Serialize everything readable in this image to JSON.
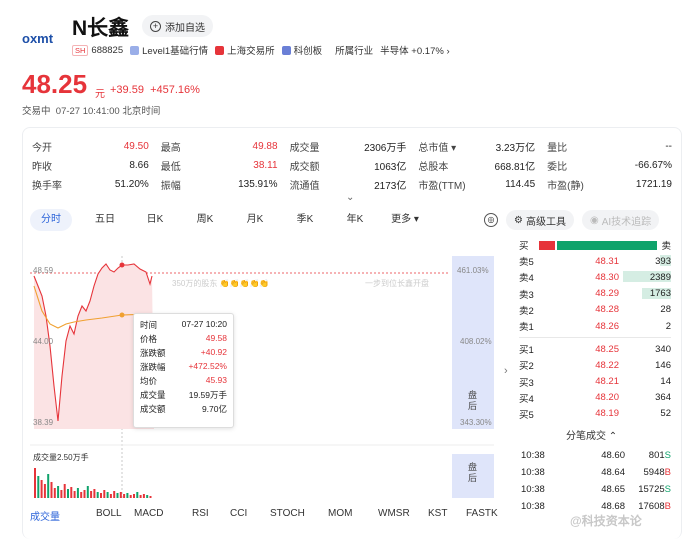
{
  "stock": {
    "name": "N长鑫",
    "add_label": "添加自选",
    "code_tag": "SH",
    "code": "688825",
    "level1": "Level1基础行情",
    "exchange": "上海交易所",
    "board": "科创板",
    "industry_label": "所属行业",
    "industry": "半导体 +0.17%",
    "industry_chevron": "›",
    "price": "48.25",
    "price_unit": "元",
    "change": "+39.59",
    "change_pct": "+457.16%",
    "status": "交易中",
    "time": "07-27 10:41:00 北京时间"
  },
  "stats": [
    [
      [
        "今开",
        "49.50",
        "red"
      ],
      [
        "最高",
        "49.88",
        "red"
      ],
      [
        "成交量",
        "2306万手",
        ""
      ],
      [
        "总市值 ▾",
        "3.23万亿",
        ""
      ],
      [
        "量比",
        "--",
        ""
      ]
    ],
    [
      [
        "昨收",
        "8.66",
        ""
      ],
      [
        "最低",
        "38.11",
        "red"
      ],
      [
        "成交额",
        "1063亿",
        ""
      ],
      [
        "总股本",
        "668.81亿",
        ""
      ],
      [
        "委比",
        "-66.67%",
        ""
      ]
    ],
    [
      [
        "换手率",
        "51.20%",
        ""
      ],
      [
        "振幅",
        "135.91%",
        ""
      ],
      [
        "流通值",
        "2173亿",
        ""
      ],
      [
        "市盈(TTM)",
        "114.45",
        ""
      ],
      [
        "市盈(静)",
        "1721.19",
        ""
      ]
    ]
  ],
  "expand_icon": "⌄",
  "tabs": [
    "分时",
    "五日",
    "日K",
    "周K",
    "月K",
    "季K",
    "年K",
    "更多 ▾"
  ],
  "tools": {
    "target_icon": "◎",
    "draw_label": "高级工具",
    "ai_label": "AI技术追踪"
  },
  "chart": {
    "y_high": "48.59",
    "y_mid": "44.00",
    "y_low": "38.39",
    "pct_high": "461.03%",
    "pct_mid": "408.02%",
    "pct_low": "343.30%",
    "side_label_1": "盘后",
    "side_label_2": "盘后",
    "ghost_text_1": "350万的股东 👏👏👏👏👏",
    "ghost_text_2": "一步到位长鑫开盘",
    "volume_label": "成交量2.50万手",
    "colors": {
      "up": "#e6343a",
      "avg": "#f0a030",
      "fill": "#fbe3e4"
    }
  },
  "tooltip": {
    "rows": [
      [
        "时间",
        "07-27 10:20",
        ""
      ],
      [
        "价格",
        "49.58",
        "red"
      ],
      [
        "涨跌额",
        "+40.92",
        "red"
      ],
      [
        "涨跌幅",
        "+472.52%",
        "red"
      ],
      [
        "均价",
        "45.93",
        "red"
      ],
      [
        "成交量",
        "19.59万手",
        ""
      ],
      [
        "成交额",
        "9.70亿",
        ""
      ]
    ]
  },
  "indicators": [
    "成交量",
    "BOLL",
    "MACD",
    "RSI",
    "CCI",
    "STOCH",
    "MOM",
    "WMSR",
    "KST",
    "FASTK"
  ],
  "orderbook": {
    "buy_label": "买",
    "sell_label": "卖",
    "asks": [
      [
        "卖5",
        "48.31",
        "393",
        0.22
      ],
      [
        "卖4",
        "48.30",
        "2389",
        1.0
      ],
      [
        "卖3",
        "48.29",
        "1763",
        0.6
      ],
      [
        "卖2",
        "48.28",
        "28",
        0
      ],
      [
        "卖1",
        "48.26",
        "2",
        0
      ]
    ],
    "bids": [
      [
        "买1",
        "48.25",
        "340",
        0
      ],
      [
        "买2",
        "48.22",
        "146",
        0
      ],
      [
        "买3",
        "48.21",
        "14",
        0
      ],
      [
        "买4",
        "48.20",
        "364",
        0
      ],
      [
        "买5",
        "48.19",
        "52",
        0
      ]
    ],
    "fen_label": "分笔成交 ⌃"
  },
  "trades": [
    [
      "10:38",
      "48.60",
      "801",
      "S"
    ],
    [
      "10:38",
      "48.64",
      "5948",
      "B"
    ],
    [
      "10:38",
      "48.65",
      "15725",
      "S"
    ],
    [
      "10:38",
      "48.68",
      "17608",
      "B"
    ]
  ],
  "watermark": "@科技资本论",
  "arrow": "›"
}
